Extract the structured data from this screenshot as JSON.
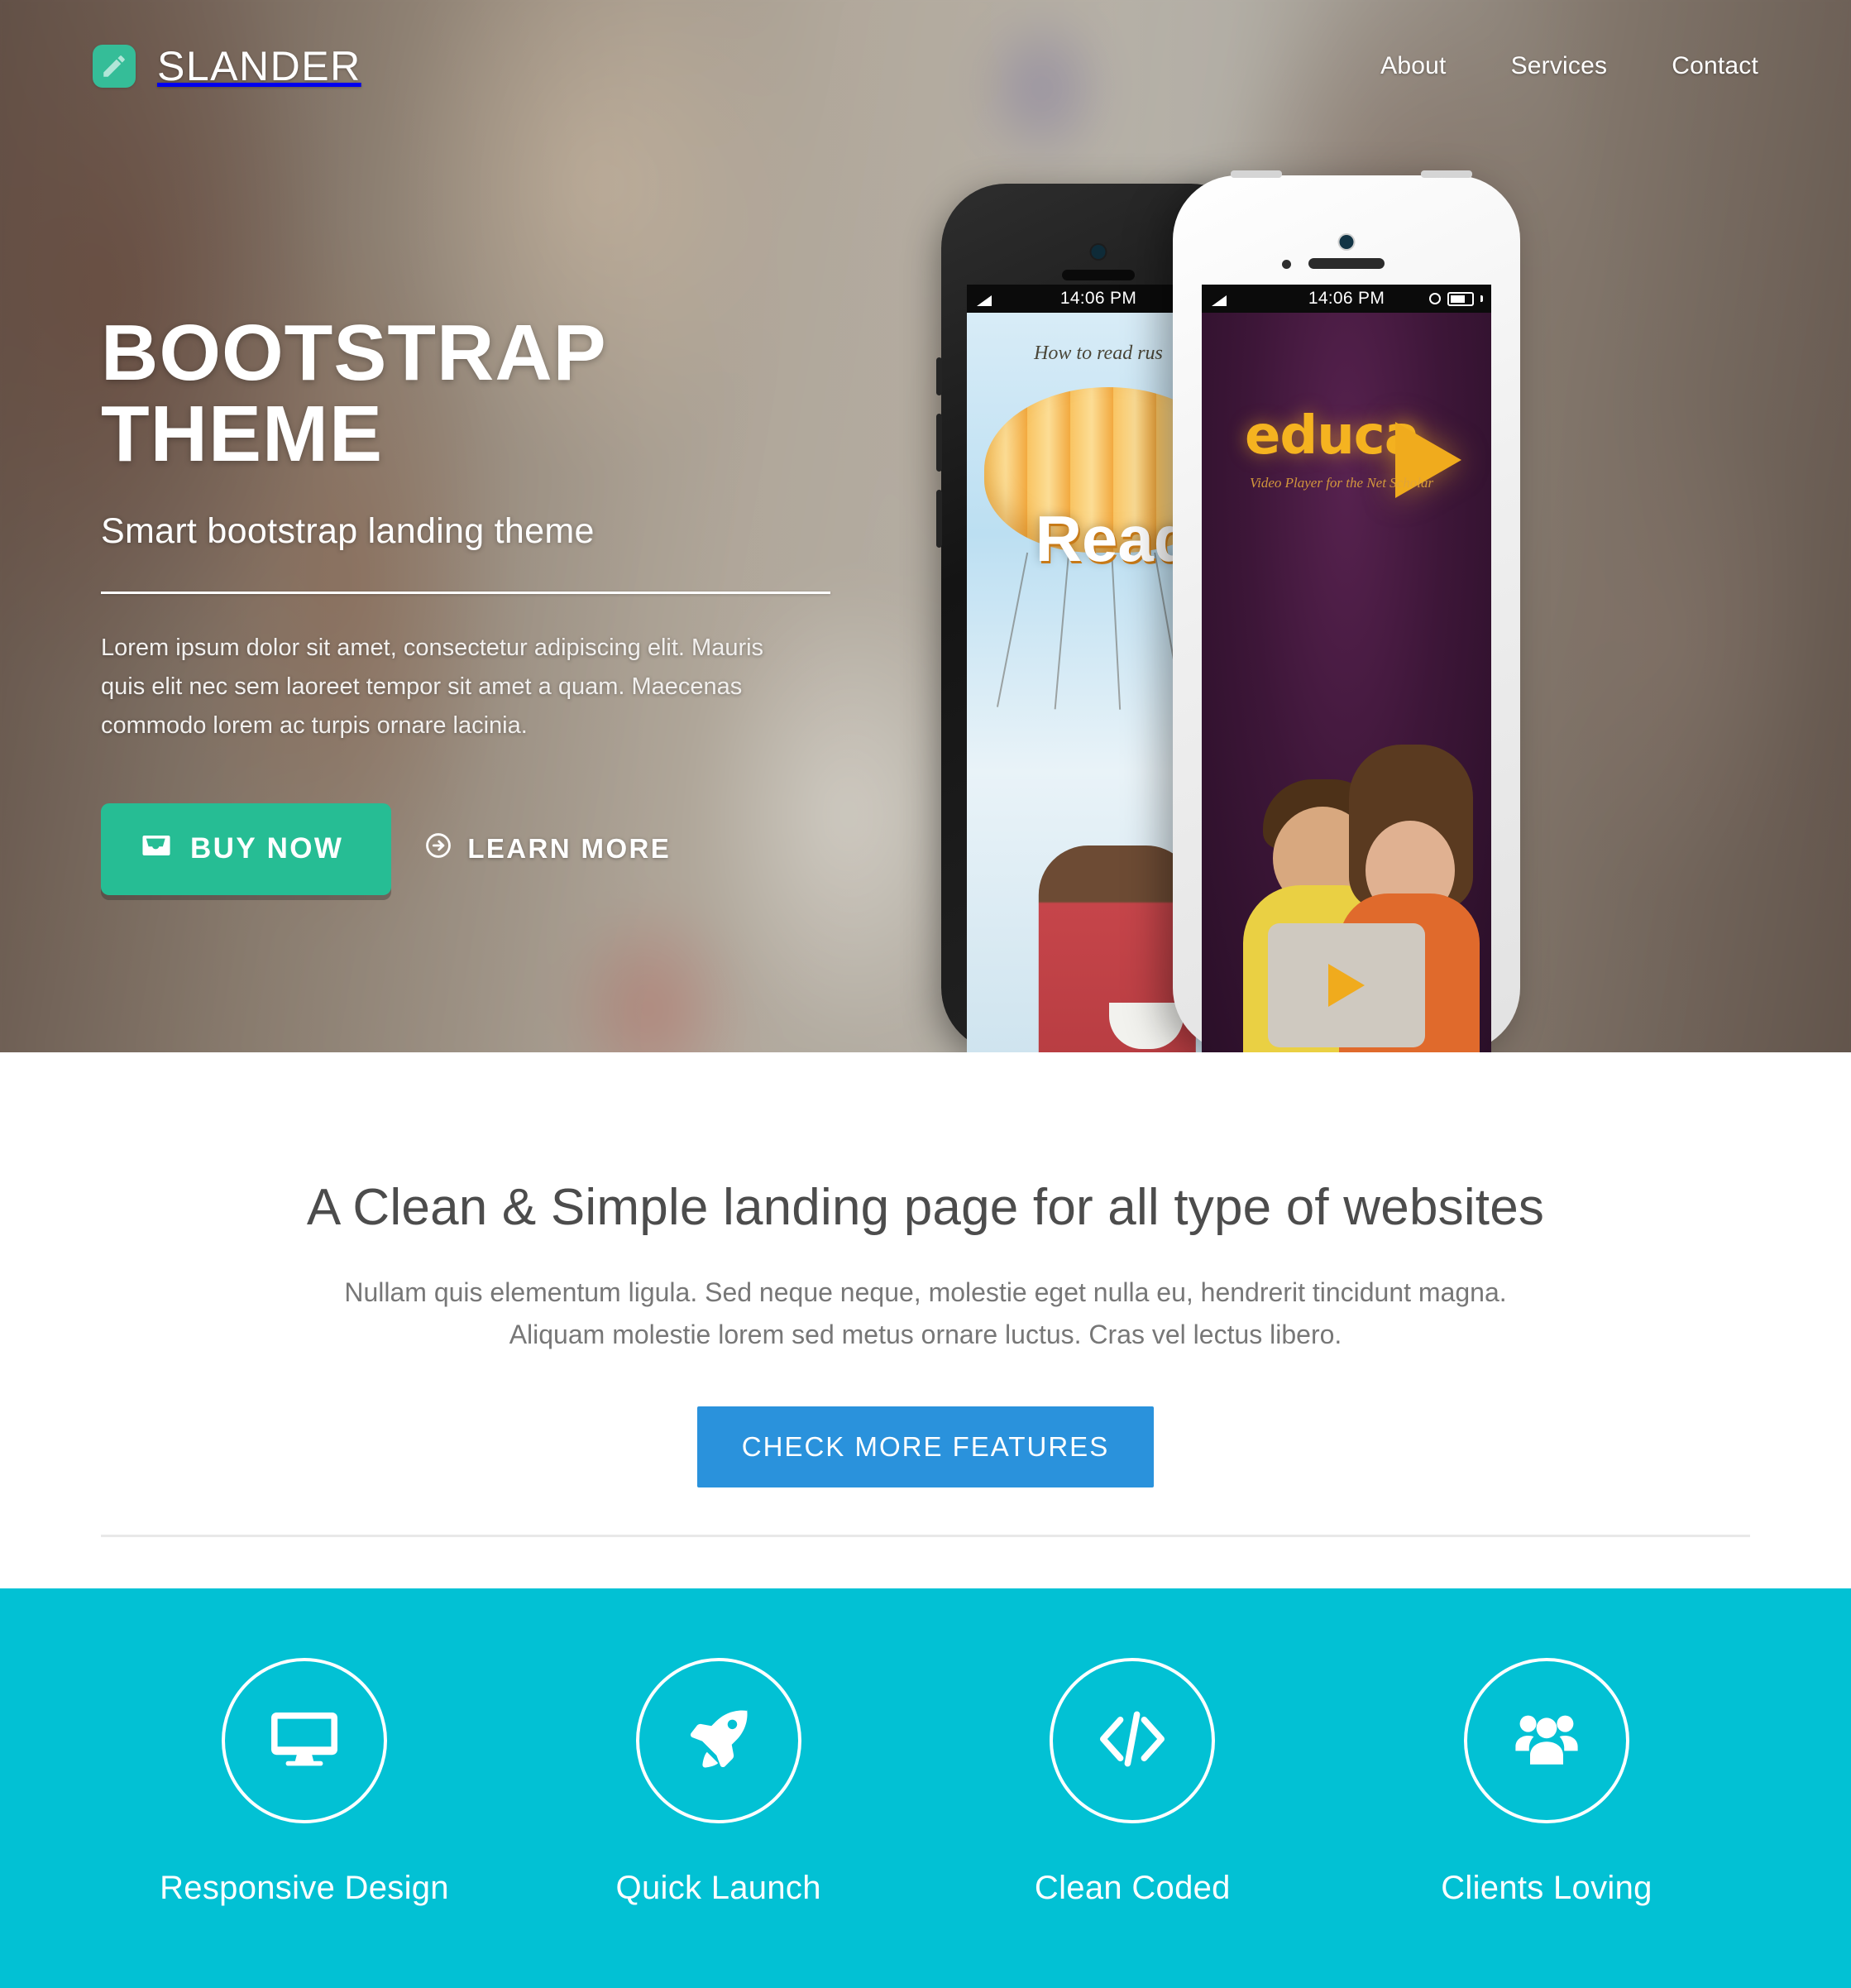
{
  "navbar": {
    "brand_name": "SLANDER",
    "brand_icon": "pencil-icon",
    "links": [
      {
        "label": "About"
      },
      {
        "label": "Services"
      },
      {
        "label": "Contact"
      }
    ]
  },
  "hero": {
    "title_line1": "BOOTSTRAP",
    "title_line2": "THEME",
    "subtitle": "Smart bootstrap landing theme",
    "paragraph": "Lorem ipsum dolor sit amet, consectetur adipiscing elit. Mauris quis elit nec sem laoreet tempor sit amet a quam. Maecenas commodo lorem ac turpis ornare lacinia.",
    "buy_button": "BUY NOW",
    "buy_icon": "inbox-icon",
    "learn_link": "LEARN MORE",
    "learn_icon": "arrow-circle-right-icon",
    "phones": {
      "black": {
        "status_time": "14:06 PM",
        "app_caption": "How to read rus",
        "app_word": "Read"
      },
      "white": {
        "status_time": "14:06 PM",
        "app_word": "educa",
        "app_tagline": "Video Player for the Net Scholar"
      }
    }
  },
  "intro": {
    "heading": "A Clean & Simple landing page for all type of websites",
    "paragraph_line1": "Nullam quis elementum ligula. Sed neque neque, molestie eget nulla eu, hendrerit tincidunt magna.",
    "paragraph_line2": "Aliquam molestie lorem sed metus ornare luctus. Cras vel lectus libero.",
    "cta_button": "CHECK MORE FEATURES"
  },
  "features": {
    "items": [
      {
        "label": "Responsive Design",
        "icon": "monitor-icon"
      },
      {
        "label": "Quick Launch",
        "icon": "rocket-icon"
      },
      {
        "label": "Clean Coded",
        "icon": "code-brackets-icon"
      },
      {
        "label": "Clients Loving",
        "icon": "users-group-icon"
      }
    ]
  },
  "colors": {
    "brand_green": "#26bd94",
    "accent_blue": "#2a92dc",
    "feature_teal": "#02c1d4",
    "logo_green": "#35bd98"
  }
}
